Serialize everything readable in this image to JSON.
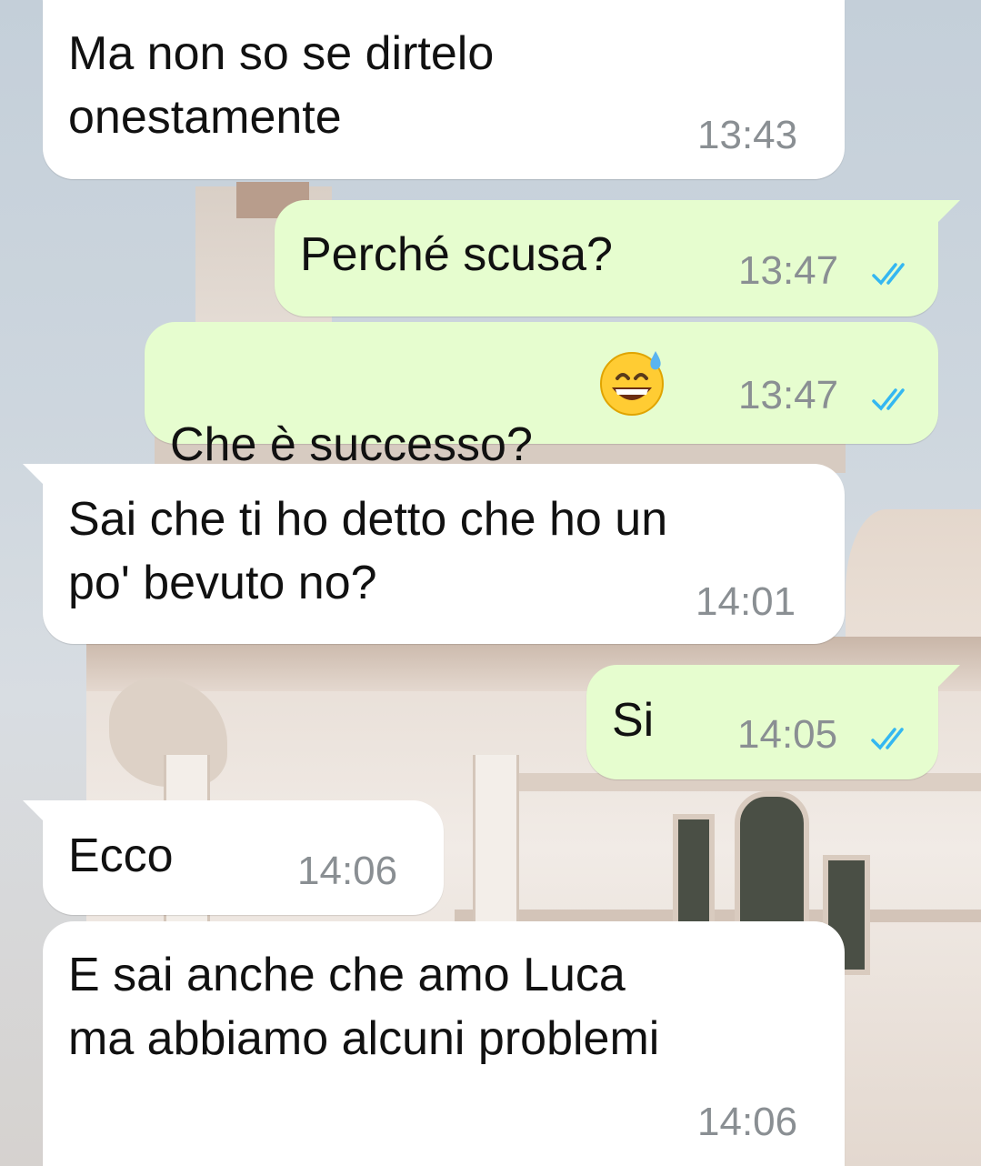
{
  "messages": [
    {
      "direction": "incoming",
      "text": "Ma non so se dirtelo\nonestamente",
      "time": "13:43"
    },
    {
      "direction": "outgoing",
      "text": "Perché scusa?",
      "time": "13:47",
      "status": "read"
    },
    {
      "direction": "outgoing",
      "text": "Che è successo?",
      "emoji": "😅",
      "time": "13:47",
      "status": "read"
    },
    {
      "direction": "incoming",
      "text": "Sai che ti ho detto che ho un\npo' bevuto no?",
      "time": "14:01"
    },
    {
      "direction": "outgoing",
      "text": "Si",
      "time": "14:05",
      "status": "read"
    },
    {
      "direction": "incoming",
      "text": "Ecco",
      "time": "14:06"
    },
    {
      "direction": "incoming",
      "text": "E sai anche che amo Luca\nma abbiamo alcuni problemi",
      "time": "14:06"
    }
  ],
  "colors": {
    "incoming_bubble": "#ffffff",
    "outgoing_bubble": "#e6fdcf",
    "timestamp": "#8a8f93",
    "read_ticks": "#34b7f1"
  },
  "icons": {
    "read_receipt": "double-check-icon",
    "emoji": "grinning-face-with-sweat-emoji"
  }
}
